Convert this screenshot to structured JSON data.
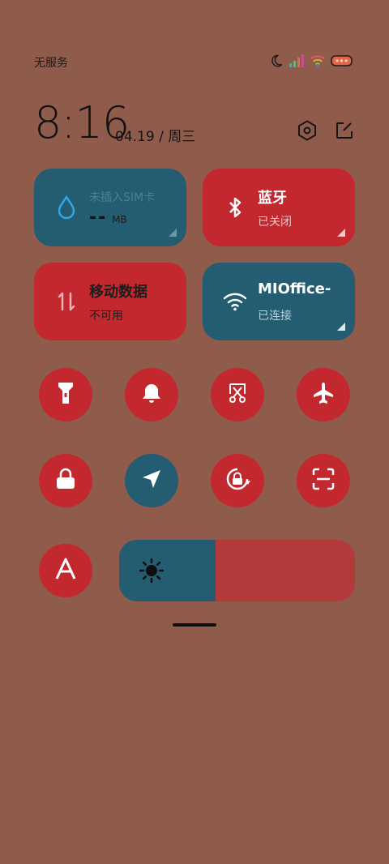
{
  "status_bar": {
    "carrier": "无服务",
    "icons": [
      "moon-icon",
      "signal-icon",
      "wifi-icon",
      "battery-icon"
    ]
  },
  "header": {
    "time": "8:16",
    "date": "04.19 / 周三",
    "actions": [
      "settings-hex-icon",
      "edit-icon"
    ]
  },
  "tiles": {
    "data_usage": {
      "title": "未插入SIM卡",
      "value": "--",
      "unit": "MB",
      "icon": "water-drop-icon"
    },
    "bluetooth": {
      "title": "蓝牙",
      "status": "已关闭",
      "icon": "bluetooth-icon"
    },
    "mobile_data": {
      "title": "移动数据",
      "status": "不可用",
      "icon": "mobile-data-arrows-icon"
    },
    "wifi": {
      "title": "MIOffice-",
      "status": "已连接",
      "icon": "wifi-icon"
    }
  },
  "toggles": [
    {
      "name": "flashlight",
      "icon": "flashlight-icon",
      "active": true
    },
    {
      "name": "mute",
      "icon": "bell-icon",
      "active": true
    },
    {
      "name": "screenshot",
      "icon": "scissors-icon",
      "active": true
    },
    {
      "name": "airplane",
      "icon": "airplane-icon",
      "active": true
    },
    {
      "name": "lock",
      "icon": "lock-icon",
      "active": true
    },
    {
      "name": "location",
      "icon": "location-arrow-icon",
      "active": false
    },
    {
      "name": "rotation-lock",
      "icon": "rotation-lock-icon",
      "active": true
    },
    {
      "name": "scanner",
      "icon": "scan-icon",
      "active": true
    },
    {
      "name": "auto-brightness",
      "icon": "letter-a-icon",
      "active": true
    }
  ],
  "brightness": {
    "level": 0.41,
    "icon": "sun-icon"
  },
  "colors": {
    "background": "#8f5b4b",
    "tile_blue": "#245c72",
    "tile_red": "#c3282e",
    "slider_track": "#b23a3a"
  }
}
